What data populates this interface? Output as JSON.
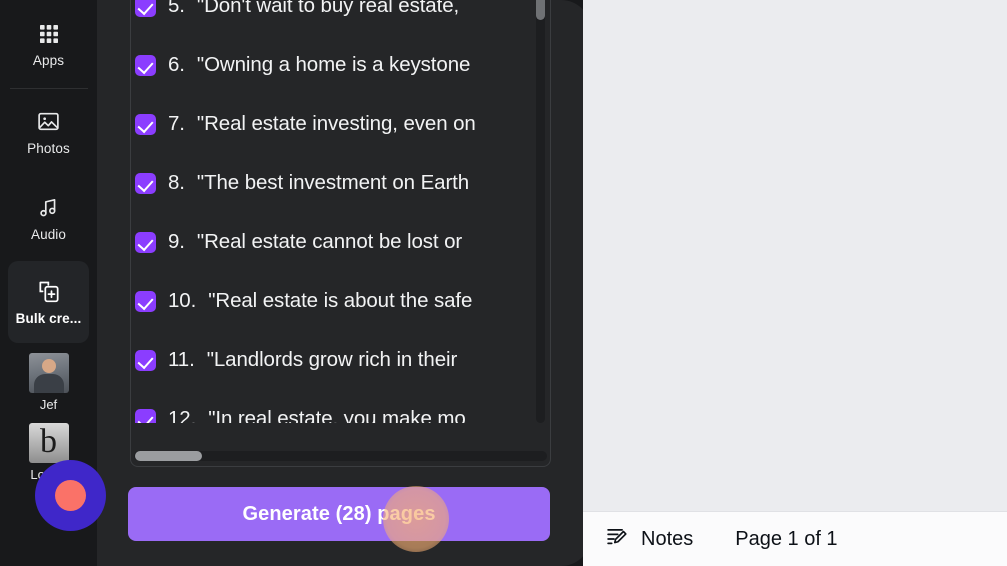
{
  "sidebar": {
    "items": [
      {
        "label": "Apps",
        "icon": "apps-grid-icon",
        "active": false
      },
      {
        "label": "Photos",
        "icon": "image-icon",
        "active": false
      },
      {
        "label": "Audio",
        "icon": "music-note-icon",
        "active": false
      },
      {
        "label": "Bulk cre...",
        "icon": "bulk-create-icon",
        "active": true
      }
    ],
    "tiles": [
      {
        "label": "Jef",
        "kind": "person-photo"
      },
      {
        "label": "Lodge",
        "kind": "logo-b"
      }
    ]
  },
  "bulk_create": {
    "quotes": [
      {
        "number": "5.",
        "text": "\"Don't wait to buy real estate,"
      },
      {
        "number": "6.",
        "text": "\"Owning a home is a keystone"
      },
      {
        "number": "7.",
        "text": "\"Real estate investing, even on"
      },
      {
        "number": "8.",
        "text": "\"The best investment on Earth"
      },
      {
        "number": "9.",
        "text": "\"Real estate cannot be lost or"
      },
      {
        "number": "10.",
        "text": "\"Real estate is about the safe"
      },
      {
        "number": "11.",
        "text": "\"Landlords grow rich in their"
      },
      {
        "number": "12.",
        "text": "\"In real estate, you make mo"
      }
    ],
    "generate_label": "Generate (28) pages",
    "accent_color": "#9a6bf5",
    "checkbox_color": "#8b3dff"
  },
  "editor": {
    "notes_label": "Notes",
    "notes_icon": "notes-pencil-icon",
    "page_indicator": "Page 1 of 1",
    "canvas_color": "#ebecef"
  },
  "overlay": {
    "cursor_ring_color": "#3f27c9",
    "cursor_center_color": "#fa7268",
    "click_highlight_color": "#f7b074"
  }
}
